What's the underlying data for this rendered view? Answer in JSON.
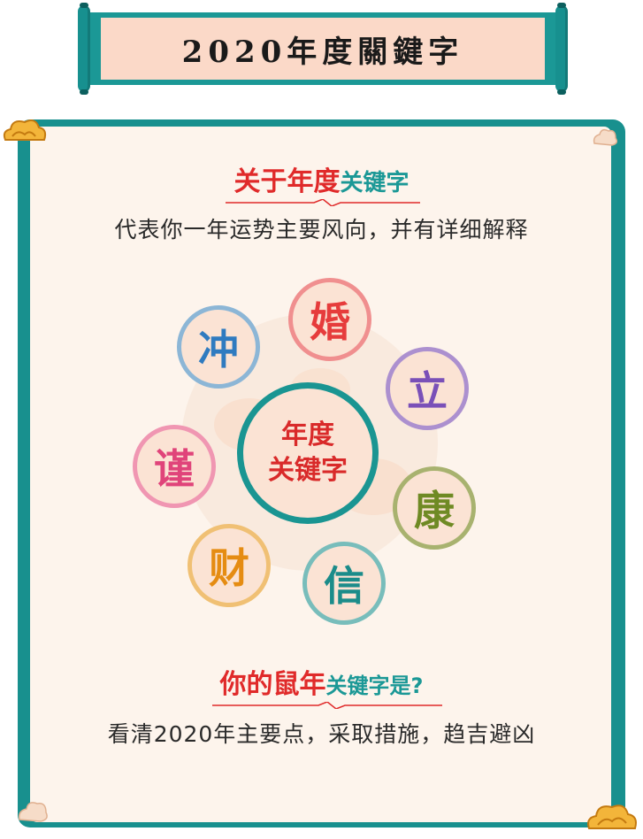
{
  "banner": {
    "title": "2020年度關鍵字"
  },
  "section1": {
    "heading_red": "关于年度",
    "heading_teal": "关键字",
    "description": "代表你一年运势主要风向，并有详细解释"
  },
  "center": {
    "line1": "年度",
    "line2": "关键字"
  },
  "keywords": [
    {
      "char": "婚",
      "color": "#e63c3c"
    },
    {
      "char": "冲",
      "color": "#2f7bc0"
    },
    {
      "char": "立",
      "color": "#7a50b8"
    },
    {
      "char": "谨",
      "color": "#e0447a"
    },
    {
      "char": "康",
      "color": "#6f8a24"
    },
    {
      "char": "财",
      "color": "#e58c12"
    },
    {
      "char": "信",
      "color": "#1b8c8a"
    }
  ],
  "section2": {
    "heading_red": "你的鼠年",
    "heading_teal": "关键字是?",
    "description": "看清2020年主要点，采取措施，趋吉避凶"
  },
  "colors": {
    "teal": "#1b9896",
    "red": "#e02a2a",
    "cream": "#fdf4ec",
    "peach": "#fbd9c8"
  }
}
